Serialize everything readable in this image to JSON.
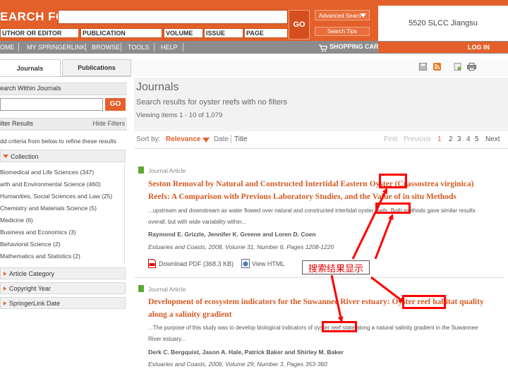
{
  "header": {
    "search_title": "EARCH FOR",
    "field_labels": [
      "UTHOR OR EDITOR",
      "PUBLICATION",
      "VOLUME",
      "ISSUE",
      "PAGE"
    ],
    "go_label": "GO",
    "advanced_search": "Advanced Search",
    "search_tips": "Search Tips",
    "institution": "5520 SLCC Jiangsu"
  },
  "nav": {
    "items": [
      "OME",
      "MY SPRINGERLINK",
      "BROWSE",
      "TOOLS",
      "HELP"
    ],
    "cart": "SHOPPING CART",
    "login": "LOG IN"
  },
  "sidebar": {
    "tabs": [
      "Journals",
      "Publications"
    ],
    "search_within": "earch Within Journals",
    "go_label": "GO",
    "filter_results": "ilter Results",
    "hide_filters": "Hide Filters",
    "add_criteria": "dd criteria from below to refine these results",
    "collection_label": "Collection",
    "collection_items": [
      "Biomedical and Life Sciences (347)",
      "arth and Environmental Science (460)",
      "Humanities, Social Sciences and Law (25)",
      "Chemistry and Materials Science (5)",
      "Medicine (6)",
      "Business and Economics (3)",
      "Behavioral Science (2)",
      "Mathematics and Statistics (2)"
    ],
    "collapsed_sections": [
      "Article Category",
      "Copyright Year",
      "SpringerLink Date"
    ]
  },
  "main": {
    "heading": "Journals",
    "query_line": "Search results for oyster reefs with no filters",
    "viewing": "Viewing items 1 - 10 of 1,079",
    "sort_by": "Sort by:",
    "sort_relevance": "Relevance",
    "sort_date": "Date",
    "sort_title": "Title",
    "pagination": {
      "first": "First",
      "previous": "Previous",
      "pages": [
        "1",
        "2",
        "3",
        "4",
        "5"
      ],
      "next": "Next",
      "current_page": 1
    },
    "results": [
      {
        "type": "Journal Article",
        "title_line1": "Seston Removal by Natural and Constructed Intertidal Eastern Oyster (Crassostrea virginica)",
        "title_line2": "Reefs: A Comparison with Previous Laboratory Studies, and the Value of in situ Methods",
        "snippet_line1": "...upstream and downstream as water flowed over natural and constructed intertidal oyster reefs. Both methods gave similar results",
        "snippet_line2": "overall, but with wide variability within...",
        "authors": "Raymond E. Grizzle, Jennifer K. Greene and Loren D. Coen",
        "source": "Estuaries and Coasts, 2008, Volume 31, Number 6, Pages 1208-1220",
        "download_pdf": "Download PDF (368.3 KB)",
        "view_html": "View HTML"
      },
      {
        "type": "Journal Article",
        "title_line1": "Development of ecosystem indicators for the Suwannee River estuary: Oyster reef habitat quality",
        "title_line2": "along a salinity gradient",
        "snippet_line1": "...The purpose of this study was to develop biological indicators of oyster reef state along a natural salinity gradient in the Suwannee",
        "snippet_line2": "River estuary...",
        "authors": "Derk C. Bergquist, Jason A. Hale, Patrick Baker and Shirley M. Baker",
        "source": "Estuaries and Coasts, 2006, Volume 29, Number 3, Pages 353-360"
      }
    ]
  },
  "annotation": {
    "note": "搜索结果显示",
    "color": "#ff0000"
  },
  "colors": {
    "brand_orange": "#e3602a",
    "nav_gray": "#8c8c8c",
    "link_orange": "#d35a24",
    "highlight_red": "#ff0000",
    "journal_green": "#5aaa32"
  },
  "icons": [
    "cart-icon",
    "save-icon",
    "rss-icon",
    "bookmark-icon",
    "print-icon",
    "pdf-icon",
    "html-icon",
    "dropdown-arrow-icon",
    "sort-arrow-icon",
    "expand-triangle-icon"
  ]
}
